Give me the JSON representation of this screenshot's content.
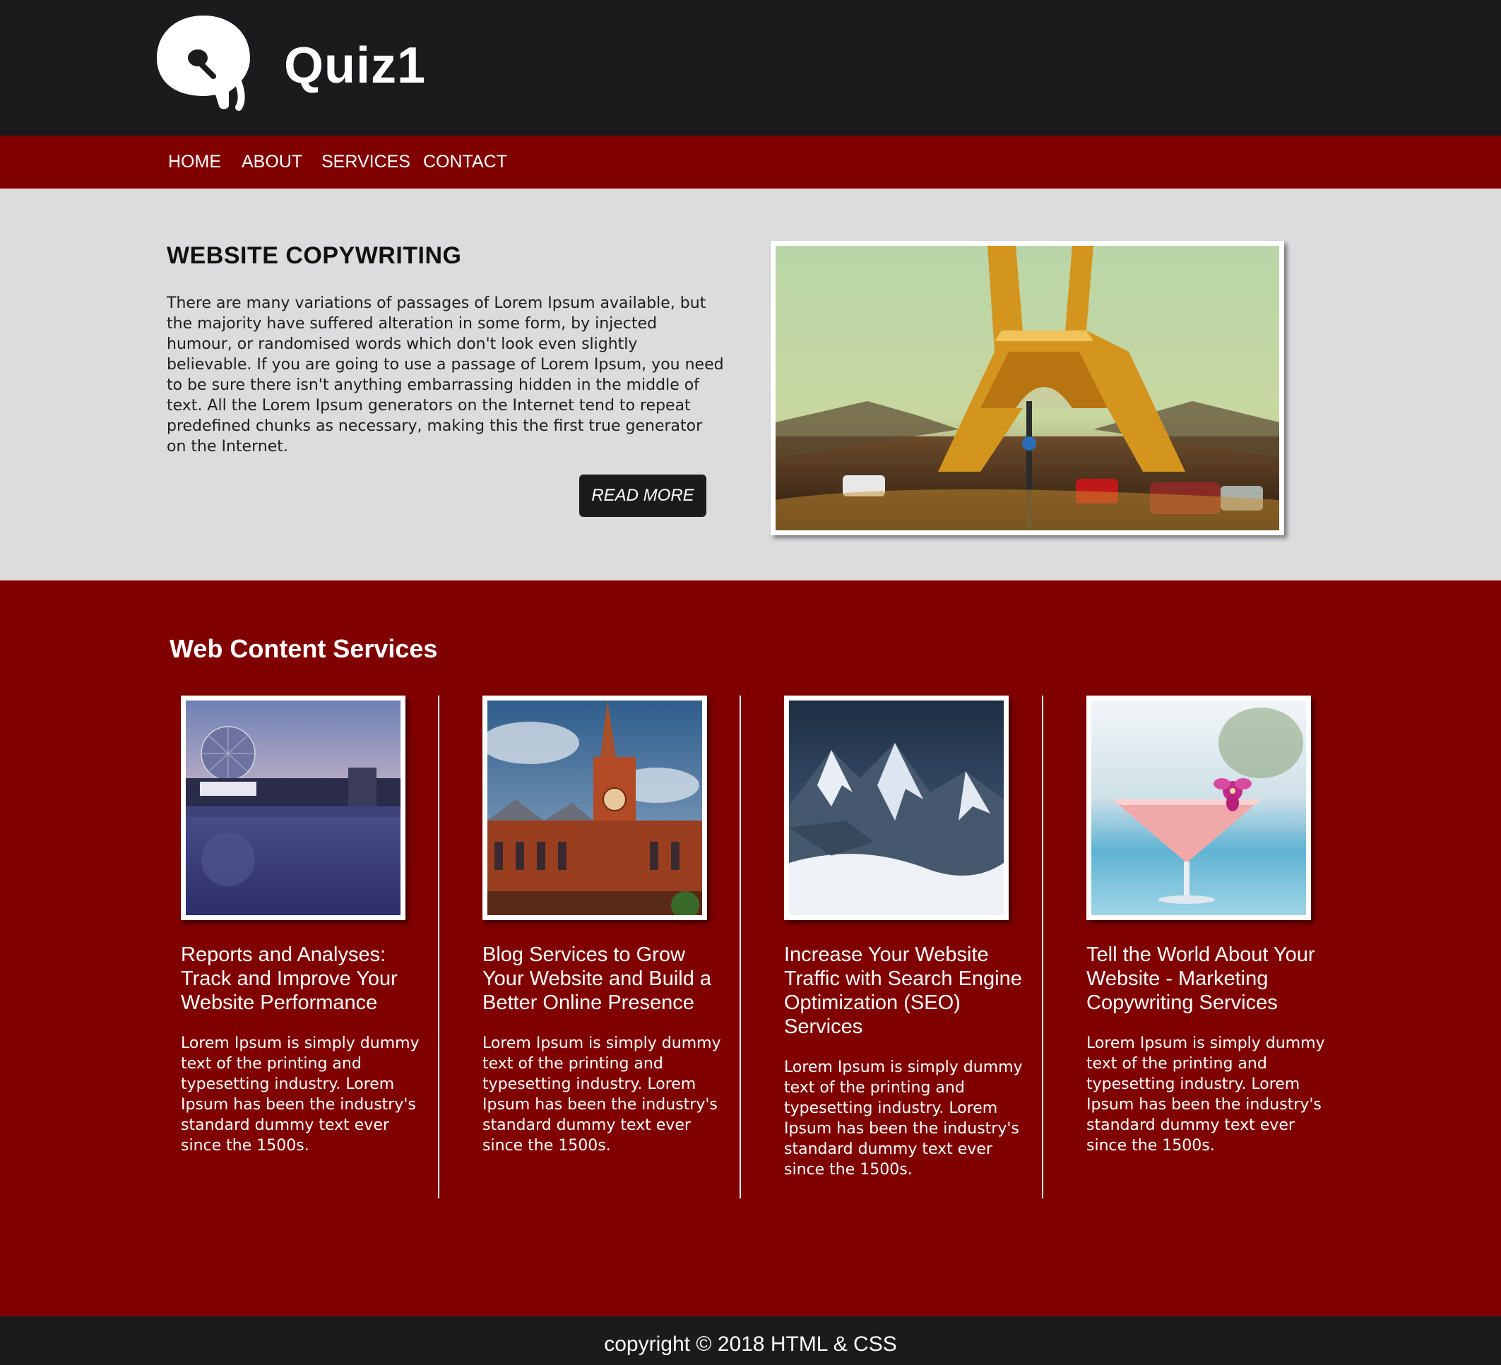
{
  "header": {
    "logo_icon": "q-logo-icon",
    "site_title": "Quiz1"
  },
  "nav": {
    "items": [
      {
        "label": "HOME"
      },
      {
        "label": "ABOUT"
      },
      {
        "label": "SERVICES"
      },
      {
        "label": "CONTACT"
      }
    ]
  },
  "hero": {
    "title": "WEBSITE COPYWRITING",
    "text": "There are many variations of passages of Lorem Ipsum available, but the majority have suffered alteration in some form, by injected humour, or randomised words which don't look even slightly believable. If you are going to use a passage of Lorem Ipsum, you need to be sure there isn't anything embarrassing hidden in the middle of text. All the Lorem Ipsum generators on the Internet tend to repeat predefined chunks as necessary, making this the first true generator on the Internet.",
    "button_label": "READ MORE",
    "image": "eiffel-tower-photo"
  },
  "services": {
    "title": "Web Content Services",
    "cards": [
      {
        "image": "geodesic-dome-waterfront-photo",
        "title": "Reports and Analyses: Track and Improve Your Website Performance",
        "text": "Lorem Ipsum is simply dummy text of the printing and typesetting industry. Lorem Ipsum has been the industry's standard dummy text ever since the 1500s."
      },
      {
        "image": "clock-tower-building-photo",
        "title": "Blog Services to Grow Your Website and Build a Better Online Presence",
        "text": "Lorem Ipsum is simply dummy text of the printing and typesetting industry. Lorem Ipsum has been the industry's standard dummy text ever since the 1500s."
      },
      {
        "image": "snowy-mountains-photo",
        "title": "Increase Your Website Traffic with Search Engine Optimization (SEO) Services",
        "text": "Lorem Ipsum is simply dummy text of the printing and typesetting industry. Lorem Ipsum has been the industry's standard dummy text ever since the 1500s."
      },
      {
        "image": "cocktail-glass-orchid-photo",
        "title": "Tell the World About Your Website - Marketing Copywriting Services",
        "text": "Lorem Ipsum is simply dummy text of the printing and typesetting industry. Lorem Ipsum has been the industry's standard dummy text ever since the 1500s."
      }
    ]
  },
  "footer": {
    "text": "copyright © 2018 HTML & CSS"
  },
  "colors": {
    "header_bg": "#1b1a1c",
    "nav_bg": "#800000",
    "hero_bg": "#dcdbdd",
    "services_bg": "#800000",
    "footer_bg": "#1b1a1c",
    "button_bg": "#1b1a1c"
  }
}
